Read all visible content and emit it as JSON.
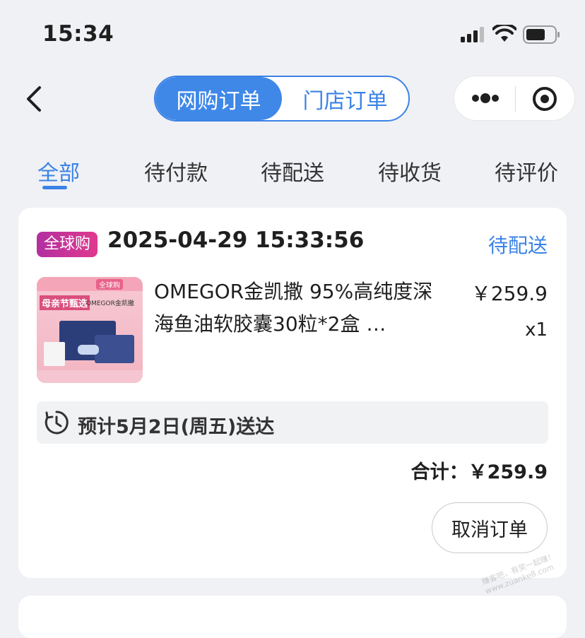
{
  "status_bar": {
    "time": "15:34"
  },
  "nav": {
    "segments": [
      {
        "label": "网购订单",
        "active": true
      },
      {
        "label": "门店订单",
        "active": false
      }
    ]
  },
  "tabs": [
    {
      "label": "全部",
      "active": true
    },
    {
      "label": "待付款",
      "active": false
    },
    {
      "label": "待配送",
      "active": false
    },
    {
      "label": "待收货",
      "active": false
    },
    {
      "label": "待评价",
      "active": false
    }
  ],
  "order": {
    "badge": "全球购",
    "datetime": "2025-04-29 15:33:56",
    "status": "待配送",
    "product": {
      "name": "OMEGOR金凯撒 95%高纯度深海鱼油软胶囊30粒*2盒 …",
      "price": "￥259.9",
      "quantity": "x1",
      "image": {
        "header_badge": "全球购",
        "promo": "母亲节甄选",
        "brand": "OMEGOR金凯撒"
      }
    },
    "delivery_text": "预计5月2日(周五)送达",
    "total_label": "合计：",
    "total_value": "￥259.9",
    "cancel_button": "取消订单"
  },
  "watermark": "赚客吧，有奖一起赚！ www.zuanke8.com",
  "colors": {
    "accent": "#3a82e6",
    "badge_gradient_start": "#b32fa1",
    "badge_gradient_end": "#e0398d",
    "page_bg": "#f0f1f5"
  }
}
